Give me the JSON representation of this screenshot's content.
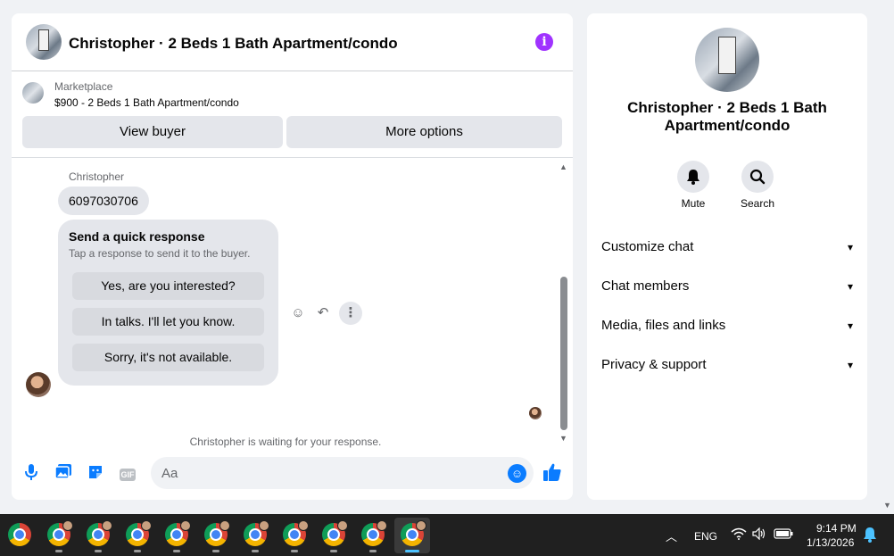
{
  "chat": {
    "title": "Christopher · 2 Beds 1 Bath Apartment/condo",
    "listing": {
      "source": "Marketplace",
      "description": "$900 - 2 Beds 1 Bath Apartment/condo",
      "view_buyer": "View buyer",
      "more_options": "More options"
    },
    "messages": {
      "sender_name": "Christopher",
      "phone_message": "6097030706",
      "quick_response_title": "Send a quick response",
      "quick_response_subtitle": "Tap a response to send it to the buyer.",
      "quick_responses": [
        "Yes, are you interested?",
        "In talks. I'll let you know.",
        "Sorry, it's not available."
      ],
      "waiting_text": "Christopher is waiting for your response."
    },
    "composer": {
      "placeholder": "Aa",
      "gif_label": "GIF"
    }
  },
  "info_panel": {
    "name": "Christopher · 2 Beds 1 Bath Apartment/condo",
    "mute_label": "Mute",
    "search_label": "Search",
    "sections": [
      "Customize chat",
      "Chat members",
      "Media, files and links",
      "Privacy & support"
    ]
  },
  "taskbar": {
    "language": "ENG",
    "time": "9:14 PM",
    "date": "1/13/2026"
  },
  "colors": {
    "accent": "#0a7cff",
    "info_purple": "#a033ff",
    "bubble_gray": "#e4e6eb",
    "page_bg": "#f0f2f5"
  }
}
